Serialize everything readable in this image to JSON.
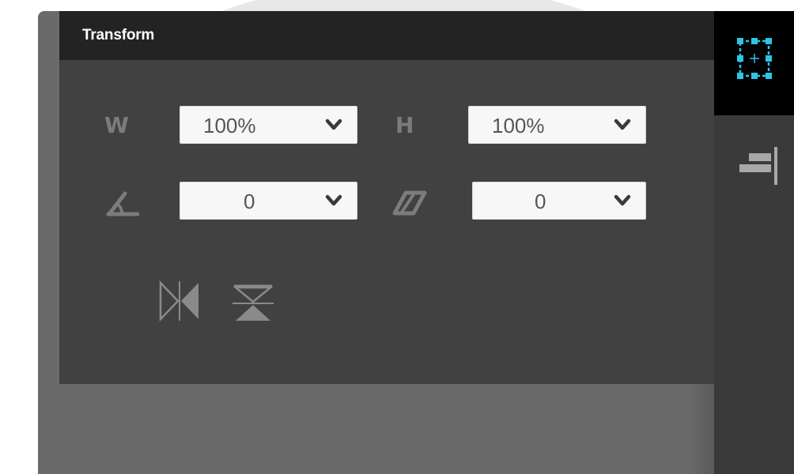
{
  "panel": {
    "title": "Transform"
  },
  "fields": {
    "width": {
      "label": "W",
      "value": "100%"
    },
    "height": {
      "label": "H",
      "value": "100%"
    },
    "rotation": {
      "value": "0"
    },
    "skew": {
      "value": "0"
    }
  },
  "icons": {
    "rotation": "angle-icon",
    "skew": "skew-parallelogram-icon",
    "flip_horizontal": "flip-horizontal-icon",
    "flip_vertical": "flip-vertical-icon",
    "transform_tool": "transform-selection-icon",
    "align_tool": "align-right-icon"
  },
  "colors": {
    "accent": "#2ec4e8",
    "panel_bg": "#414141",
    "header_bg": "#232323",
    "label": "#7c7c7c"
  }
}
